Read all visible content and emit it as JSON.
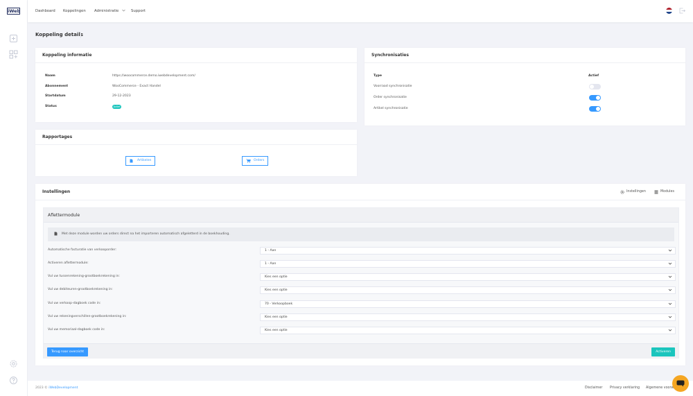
{
  "brand": {
    "logo": "iWeb"
  },
  "sidebar": {
    "icons": [
      "plus-square-icon",
      "add-widget-icon",
      "settings-icon",
      "help-icon"
    ]
  },
  "topnav": {
    "items": [
      "Dashboard",
      "Koppelingen",
      "Administratie",
      "Support"
    ],
    "language_icon": "dutch-flag-icon",
    "logout_icon": "logout-icon"
  },
  "page": {
    "title": "Koppeling details"
  },
  "info_card": {
    "title": "Koppeling informatie",
    "rows": [
      {
        "label": "Naam",
        "value": "https://woocommerce.demo.iwebdevelopment.com/"
      },
      {
        "label": "Abonnement",
        "value": "WooCommerce - Exact Handel"
      },
      {
        "label": "Startdatum",
        "value": "29-12-2023"
      },
      {
        "label": "Status",
        "value": "Actief"
      }
    ]
  },
  "sync_card": {
    "title": "Synchronisaties",
    "col_type": "Type",
    "col_active": "Actief",
    "rows": [
      {
        "label": "Voorraad synchronisatie",
        "active": false
      },
      {
        "label": "Order synchronisatie",
        "active": true
      },
      {
        "label": "Artikel synchronisatie",
        "active": true
      }
    ]
  },
  "reports_card": {
    "title": "Rapportages",
    "buttons": [
      "Artikelen",
      "Orders"
    ]
  },
  "settings_card": {
    "title": "Instellingen",
    "tools": [
      "Instellingen",
      "Modules"
    ],
    "module": {
      "title": "Aflettermodule",
      "info": "Met deze module worden uw orders direct na het importeren automatisch afgeletterd in de boekhouding.",
      "fields": [
        {
          "label": "Automatische facturatie van verkooporder:",
          "value": "1 - Aan"
        },
        {
          "label": "Activeren aflettermodule:",
          "value": "1 - Aan"
        },
        {
          "label": "Vul uw tussenrekening-grootboekrekening in:",
          "value": "Kies een optie"
        },
        {
          "label": "Vul uw debiteuren-grootboekrekening in:",
          "value": "Kies een optie"
        },
        {
          "label": "Vul uw verkoop-dagboek code in:",
          "value": "70 - Verkoopboek"
        },
        {
          "label": "Vul uw rekeningverschillen-grootboekrekening in:",
          "value": "Kies een optie"
        },
        {
          "label": "Vul uw memoriaal-dagboek code in:",
          "value": "Kies een optie"
        }
      ],
      "back_label": "Terug naar overzicht",
      "activate_label": "Activeren"
    }
  },
  "footer": {
    "year": "2023 ©",
    "company": "iWebDevelopment",
    "links": [
      "Disclaimer",
      "Privacy verklaring",
      "Algemene voorw..."
    ]
  },
  "colors": {
    "primary": "#3699ff",
    "success": "#1bc5bd",
    "chat": "#f5a623"
  }
}
